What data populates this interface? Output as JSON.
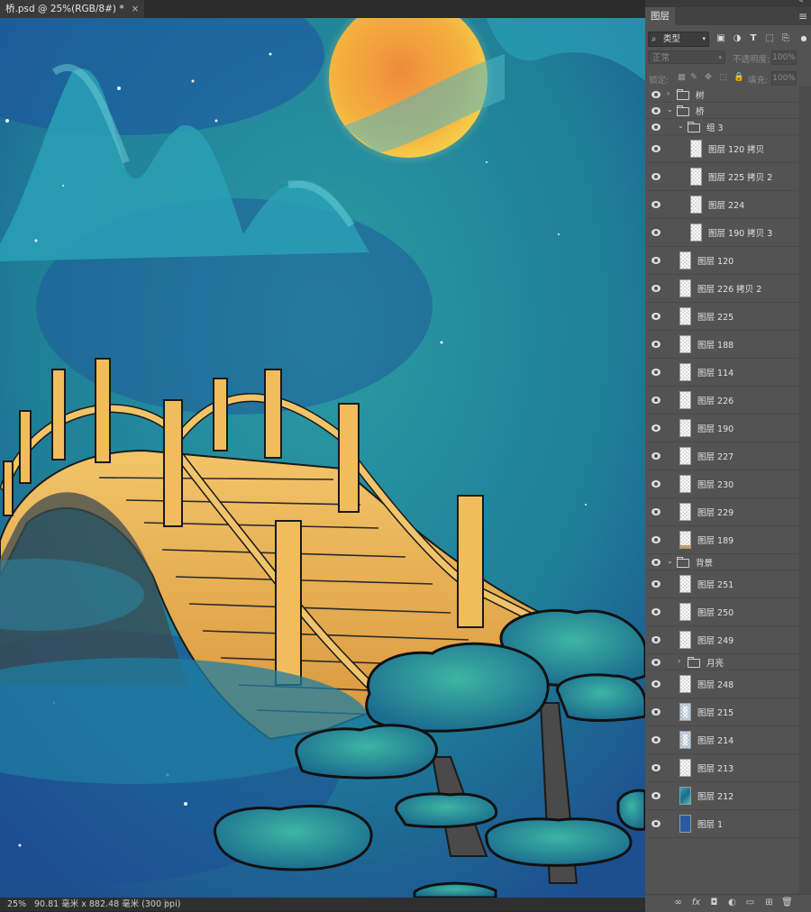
{
  "document": {
    "tab_title": "桥.psd @ 25%(RGB/8#) *",
    "close_glyph": "×"
  },
  "status": {
    "zoom": "25%",
    "doc_size": "90.81 毫米 x 882.48 毫米 (300 ppi)",
    "arrow": "〉"
  },
  "panel": {
    "tab_label": "图层",
    "menu_glyph": "≡",
    "collapse_glyph": "«",
    "close_glyph": "×",
    "filter_label": "类型",
    "filter_icons": [
      "image-filter-icon",
      "adjustment-filter-icon",
      "type-filter-icon",
      "shape-filter-icon",
      "smart-object-filter-icon"
    ],
    "blend_mode": "正常",
    "opacity_label": "不透明度:",
    "opacity_value": "100%",
    "lock_label": "锁定:",
    "fill_label": "填充:",
    "fill_value": "100%"
  },
  "layers": [
    {
      "name": "树",
      "type": "group",
      "indent": 0,
      "expanded": false
    },
    {
      "name": "桥",
      "type": "group",
      "indent": 0,
      "expanded": true
    },
    {
      "name": "组 3",
      "type": "group",
      "indent": 1,
      "expanded": true
    },
    {
      "name": "图层 120 拷贝",
      "type": "layer",
      "indent": 2
    },
    {
      "name": "图层 225 拷贝 2",
      "type": "layer",
      "indent": 2
    },
    {
      "name": "图层 224",
      "type": "layer",
      "indent": 2
    },
    {
      "name": "图层 190 拷贝 3",
      "type": "layer",
      "indent": 2
    },
    {
      "name": "图层 120",
      "type": "layer",
      "indent": 1
    },
    {
      "name": "图层 226 拷贝 2",
      "type": "layer",
      "indent": 1
    },
    {
      "name": "图层 225",
      "type": "layer",
      "indent": 1
    },
    {
      "name": "图层 188",
      "type": "layer",
      "indent": 1
    },
    {
      "name": "图层 114",
      "type": "layer",
      "indent": 1
    },
    {
      "name": "图层 226",
      "type": "layer",
      "indent": 1
    },
    {
      "name": "图层 190",
      "type": "layer",
      "indent": 1
    },
    {
      "name": "图层 227",
      "type": "layer",
      "indent": 1
    },
    {
      "name": "图层 230",
      "type": "layer",
      "indent": 1
    },
    {
      "name": "图层 229",
      "type": "layer",
      "indent": 1
    },
    {
      "name": "图层 189",
      "type": "layer",
      "indent": 1,
      "thumb": "stroke"
    },
    {
      "name": "背景",
      "type": "group",
      "indent": 0,
      "expanded": true
    },
    {
      "name": "图层 251",
      "type": "layer",
      "indent": 1
    },
    {
      "name": "图层 250",
      "type": "layer",
      "indent": 1
    },
    {
      "name": "图层 249",
      "type": "layer",
      "indent": 1
    },
    {
      "name": "月亮",
      "type": "group",
      "indent": 1,
      "expanded": false
    },
    {
      "name": "图层 248",
      "type": "layer",
      "indent": 1
    },
    {
      "name": "图层 215",
      "type": "layer",
      "indent": 1,
      "thumb": "speckle"
    },
    {
      "name": "图层 214",
      "type": "layer",
      "indent": 1,
      "thumb": "speckle"
    },
    {
      "name": "图层 213",
      "type": "layer",
      "indent": 1
    },
    {
      "name": "图层 212",
      "type": "layer",
      "indent": 1,
      "thumb": "teal"
    },
    {
      "name": "图层 1",
      "type": "layer",
      "indent": 1,
      "thumb": "blue"
    }
  ],
  "bottom_icons": [
    "link-layers-icon",
    "fx-icon",
    "add-mask-icon",
    "adjustment-layer-icon",
    "new-group-icon",
    "new-layer-icon",
    "delete-layer-icon"
  ],
  "bottom_glyphs": [
    "∞",
    "fx",
    "◘",
    "◐",
    "▭",
    "⊞",
    "🗑"
  ]
}
